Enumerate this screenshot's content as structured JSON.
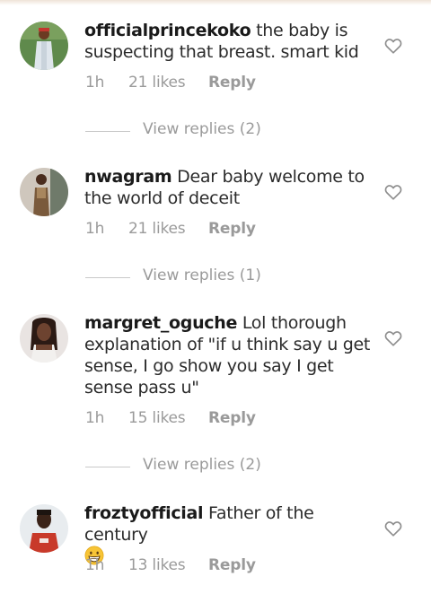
{
  "comments": [
    {
      "username": "officialprincekoko",
      "text": " the baby is suspecting that breast. smart kid",
      "time": "1h",
      "likes": "21 likes",
      "reply_label": "Reply",
      "view_replies": "View replies (2)"
    },
    {
      "username": "nwagram",
      "text": " Dear baby welcome to the world of deceit",
      "time": "1h",
      "likes": "21 likes",
      "reply_label": "Reply",
      "view_replies": "View replies (1)"
    },
    {
      "username": "margret_oguche",
      "text": " Lol thorough explanation of \"if u think say u get sense, I go show you say I get sense pass u\"",
      "time": "1h",
      "likes": "15 likes",
      "reply_label": "Reply",
      "view_replies": "View replies (2)"
    },
    {
      "username": "froztyofficial",
      "text": " Father of the century ",
      "emoji": "grinning-face-emoji",
      "time": "1h",
      "likes": "13 likes",
      "reply_label": "Reply"
    }
  ],
  "icons": {
    "like": "heart-outline-icon"
  },
  "colors": {
    "text": "#2b2b2b",
    "meta": "#9a9a9a",
    "divider": "#c8c8c8"
  }
}
